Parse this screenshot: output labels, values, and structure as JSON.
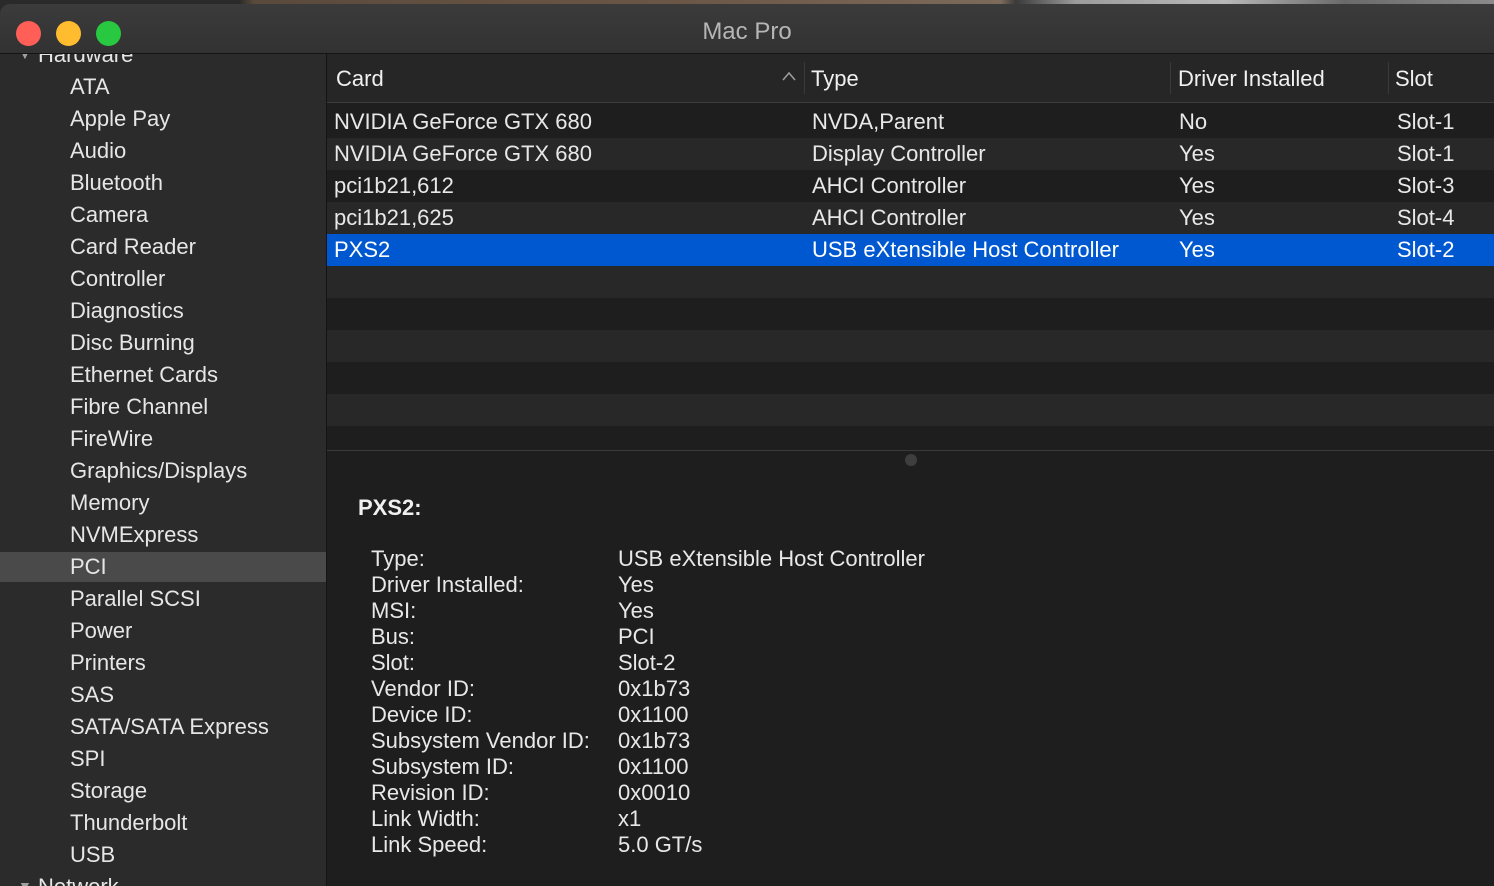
{
  "window": {
    "title": "Mac Pro"
  },
  "sidebar": {
    "hardware_section": "Hardware",
    "items": [
      "ATA",
      "Apple Pay",
      "Audio",
      "Bluetooth",
      "Camera",
      "Card Reader",
      "Controller",
      "Diagnostics",
      "Disc Burning",
      "Ethernet Cards",
      "Fibre Channel",
      "FireWire",
      "Graphics/Displays",
      "Memory",
      "NVMExpress",
      "PCI",
      "Parallel SCSI",
      "Power",
      "Printers",
      "SAS",
      "SATA/SATA Express",
      "SPI",
      "Storage",
      "Thunderbolt",
      "USB"
    ],
    "selected": "PCI",
    "network_section": "Network"
  },
  "table": {
    "columns": [
      "Card",
      "Type",
      "Driver Installed",
      "Slot"
    ],
    "sort_column": "Card",
    "rows": [
      [
        "NVIDIA GeForce GTX 680",
        "NVDA,Parent",
        "No",
        "Slot-1"
      ],
      [
        "NVIDIA GeForce GTX 680",
        "Display Controller",
        "Yes",
        "Slot-1"
      ],
      [
        "pci1b21,612",
        "AHCI Controller",
        "Yes",
        "Slot-3"
      ],
      [
        "pci1b21,625",
        "AHCI Controller",
        "Yes",
        "Slot-4"
      ],
      [
        "PXS2",
        "USB eXtensible Host Controller",
        "Yes",
        "Slot-2"
      ]
    ],
    "selected_row": 4
  },
  "detail": {
    "title": "PXS2:",
    "fields": [
      [
        "Type:",
        "USB eXtensible Host Controller"
      ],
      [
        "Driver Installed:",
        "Yes"
      ],
      [
        "MSI:",
        "Yes"
      ],
      [
        "Bus:",
        "PCI"
      ],
      [
        "Slot:",
        "Slot-2"
      ],
      [
        "Vendor ID:",
        "0x1b73"
      ],
      [
        "Device ID:",
        "0x1100"
      ],
      [
        "Subsystem Vendor ID:",
        "0x1b73"
      ],
      [
        "Subsystem ID:",
        "0x1100"
      ],
      [
        "Revision ID:",
        "0x0010"
      ],
      [
        "Link Width:",
        "x1"
      ],
      [
        "Link Speed:",
        "5.0 GT/s"
      ]
    ]
  },
  "colors": {
    "selection": "#0058d0",
    "sidebar_selection": "#4a4a4a"
  }
}
